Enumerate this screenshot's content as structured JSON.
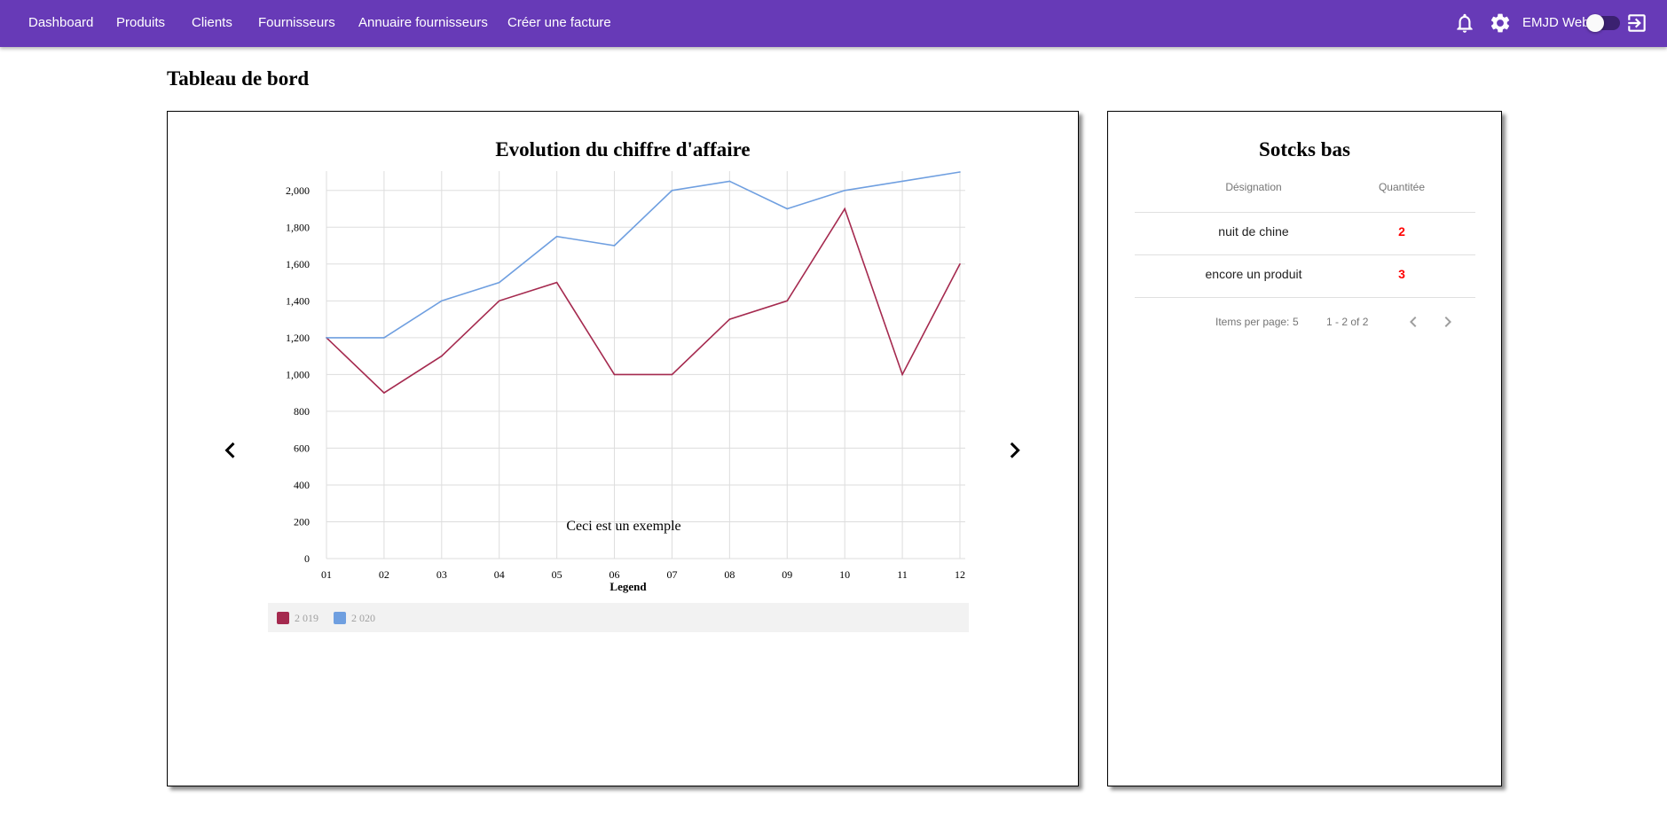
{
  "nav": {
    "items": [
      {
        "label": "Dashboard"
      },
      {
        "label": "Produits"
      },
      {
        "label": "Clients"
      },
      {
        "label": "Fournisseurs"
      },
      {
        "label": "Annuaire fournisseurs"
      },
      {
        "label": "Créer une facture"
      }
    ],
    "app_name": "EMJD Web",
    "icons": [
      "bell-icon",
      "gear-icon",
      "logout-icon"
    ],
    "theme_toggle_on": false,
    "bar_color": "#673ab7"
  },
  "page": {
    "title": "Tableau de bord"
  },
  "chart_card": {
    "title": "Evolution du chiffre d'affaire",
    "annotation": "Ceci est un exemple",
    "prev_icon": "chevron-left-icon",
    "next_icon": "chevron-right-icon"
  },
  "chart_data": {
    "type": "line",
    "title": "Evolution du chiffre d'affaire",
    "x": [
      "01",
      "02",
      "03",
      "04",
      "05",
      "06",
      "07",
      "08",
      "09",
      "10",
      "11",
      "12"
    ],
    "xlabel": "Legend",
    "ylabel": "",
    "ylim": [
      0,
      2100
    ],
    "yticks": [
      0,
      200,
      400,
      600,
      800,
      1000,
      1200,
      1400,
      1600,
      1800,
      2000
    ],
    "ytick_labels": [
      "0",
      "200",
      "400",
      "600",
      "800",
      "1,000",
      "1,200",
      "1,400",
      "1,600",
      "1,800",
      "2,000"
    ],
    "grid": true,
    "legend_position": "bottom",
    "series": [
      {
        "name": "2 019",
        "color": "#a52a4f",
        "values": [
          1200,
          900,
          1100,
          1400,
          1500,
          1000,
          1000,
          1300,
          1400,
          1900,
          1000,
          1600
        ]
      },
      {
        "name": "2 020",
        "color": "#6f9fe0",
        "values": [
          1200,
          1200,
          1400,
          1500,
          1750,
          1700,
          2000,
          2050,
          1900,
          2000,
          2050,
          2100
        ]
      }
    ]
  },
  "stock_card": {
    "title": "Sotcks bas",
    "columns": [
      "Désignation",
      "Quantitée"
    ],
    "rows": [
      {
        "name": "nuit de chine",
        "qty": "2"
      },
      {
        "name": "encore un produit",
        "qty": "3"
      }
    ],
    "paginator": {
      "items_per_page_label": "Items per page:",
      "items_per_page": "5",
      "range": "1 - 2 of 2"
    },
    "qty_color": "#ff0000"
  }
}
